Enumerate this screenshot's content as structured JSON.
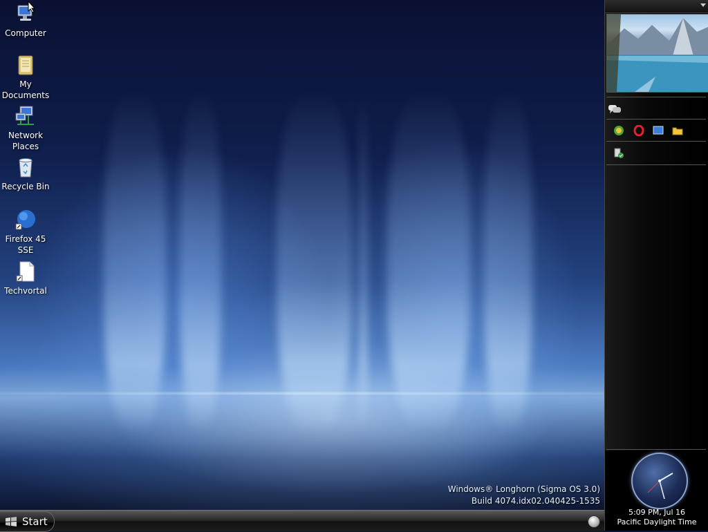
{
  "desktop": {
    "icons": [
      {
        "label": "Computer",
        "icon": "computer-icon"
      },
      {
        "label": "My Documents",
        "icon": "documents-folder-icon"
      },
      {
        "label": "Network Places",
        "icon": "network-icon"
      },
      {
        "label": "Recycle Bin",
        "icon": "recycle-bin-icon"
      },
      {
        "label": "Firefox 45 SSE",
        "icon": "firefox-icon"
      },
      {
        "label": "Techvortal",
        "icon": "file-shortcut-icon"
      }
    ],
    "watermark": {
      "line1": "Windows® Longhorn (Sigma OS 3.0)",
      "line2": "Build 4074.idx02.040425-1535"
    }
  },
  "taskbar": {
    "start_label": "Start"
  },
  "sidebar": {
    "tiles": [
      {
        "icon": "chat-bubbles-icon"
      },
      {
        "icons": [
          "green-orb-icon",
          "opera-icon",
          "monitor-icon",
          "folder-icon"
        ]
      },
      {
        "icon": "recycle-check-icon"
      }
    ],
    "clock": {
      "time_date": "5:09 PM, Jul 16",
      "timezone": "Pacific Daylight Time"
    }
  }
}
